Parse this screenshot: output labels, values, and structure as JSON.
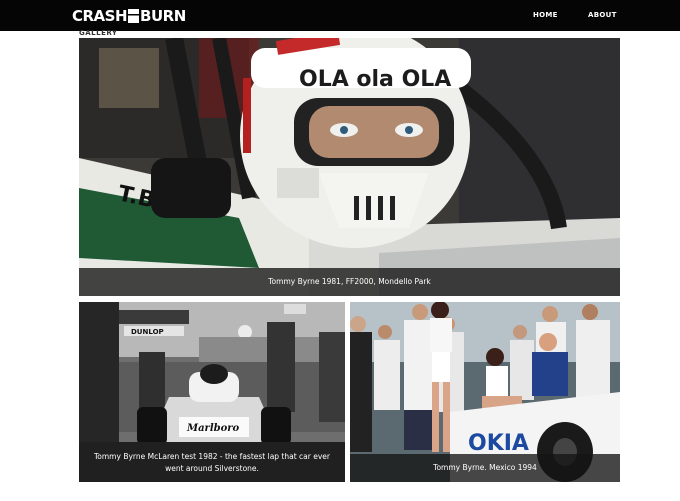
{
  "header": {
    "logo_left": "CRASH",
    "logo_right": "BURN",
    "nav": [
      "HOME",
      "ABOUT"
    ]
  },
  "page": {
    "section_label": "GALLERY"
  },
  "gallery": {
    "items": [
      {
        "caption": "Tommy Byrne 1981, FF2000, Mondello Park"
      },
      {
        "caption": "Tommy Byrne McLaren test 1982 - the fastest lap that car ever went around Silverstone."
      },
      {
        "caption": "Tommy Byrne. Mexico 1994"
      }
    ]
  }
}
